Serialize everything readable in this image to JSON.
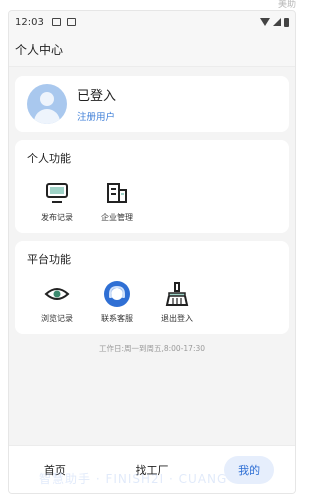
{
  "corner_text": "美助",
  "status_bar": {
    "time": "12:03",
    "icons": [
      "mail-icon",
      "notification-icon",
      "wifi-icon",
      "signal-icon",
      "battery-icon"
    ]
  },
  "header": {
    "title": "个人中心"
  },
  "profile": {
    "name": "已登入",
    "role": "注册用户",
    "avatar_color": "#a9c8ee",
    "role_color": "#3f7fd8"
  },
  "personal": {
    "title": "个人功能",
    "items": [
      {
        "label": "发布记录",
        "icon": "monitor-icon"
      },
      {
        "label": "企业管理",
        "icon": "building-icon"
      }
    ]
  },
  "platform": {
    "title": "平台功能",
    "items": [
      {
        "label": "浏览记录",
        "icon": "eye-icon"
      },
      {
        "label": "联系客服",
        "icon": "customer-service-icon"
      },
      {
        "label": "退出登入",
        "icon": "broom-icon"
      }
    ]
  },
  "work_hours": "工作日:周一到周五,8:00-17:30",
  "tabbar": {
    "items": [
      {
        "label": "首页",
        "active": false
      },
      {
        "label": "找工厂",
        "active": false
      },
      {
        "label": "我的",
        "active": true
      }
    ],
    "active_color": "#2f6fd4"
  },
  "watermark": "智慧助手 · FINISH2I · CUANG"
}
